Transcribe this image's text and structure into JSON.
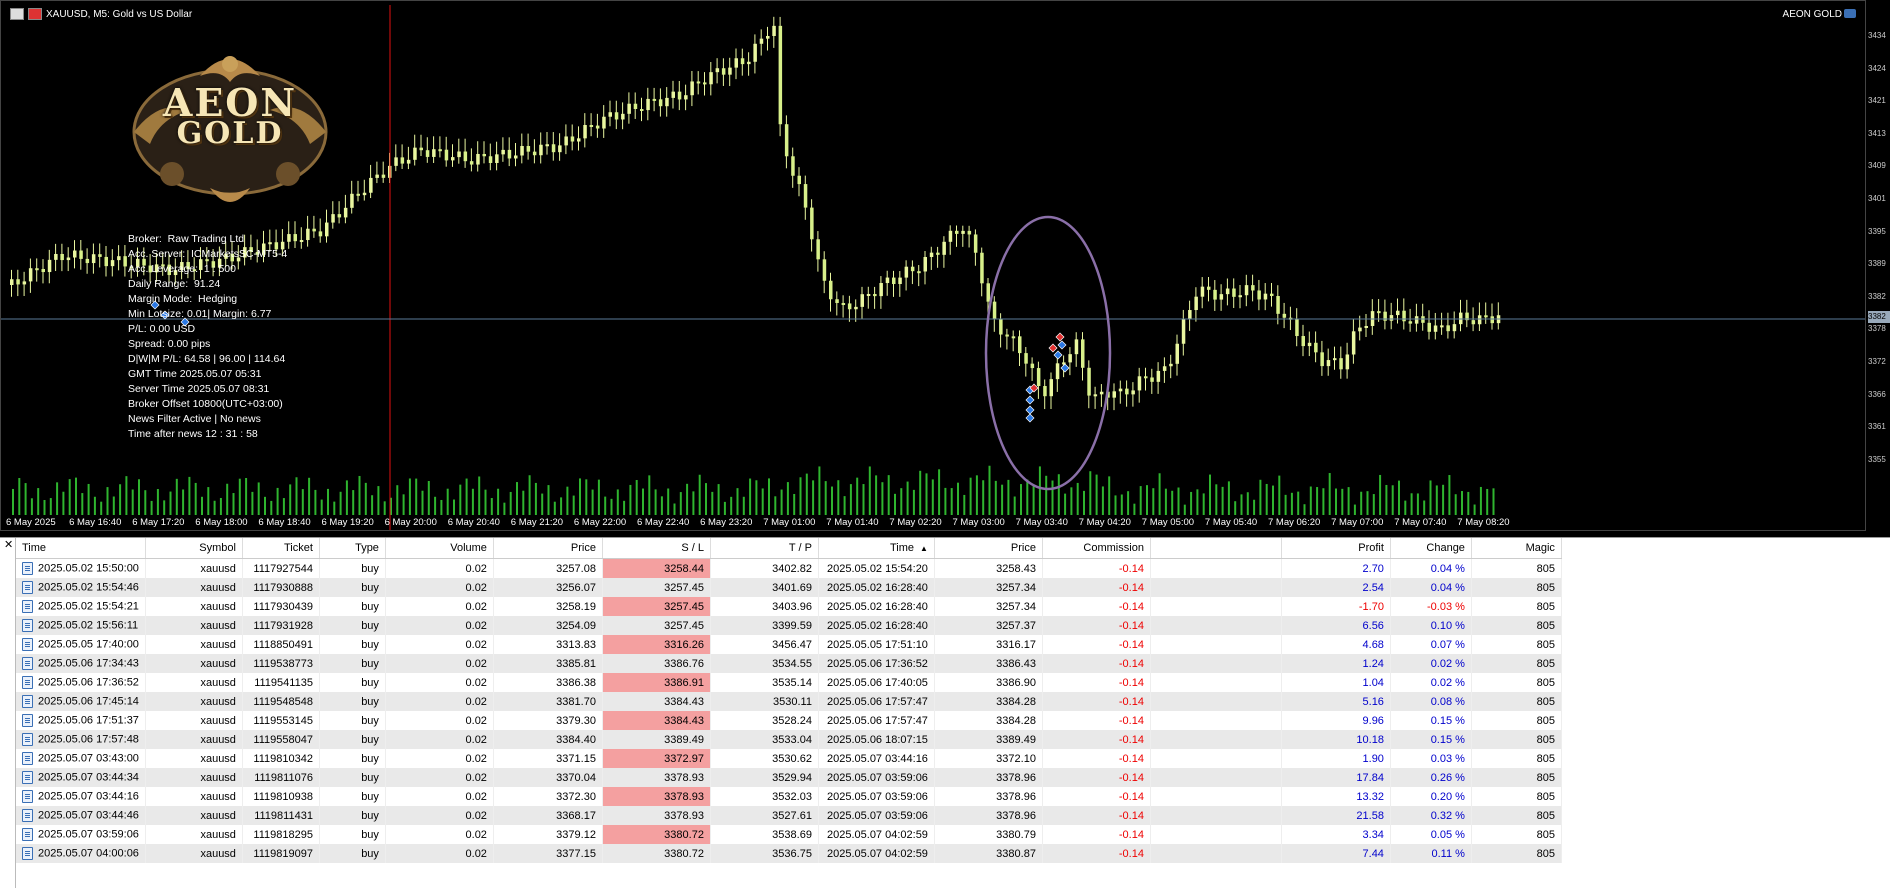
{
  "chart": {
    "symbol_title": "XAUUSD, M5:  Gold vs US Dollar",
    "ea_name": "AEON GOLD",
    "logo_line1": "AEON",
    "logo_line2": "GOLD",
    "current_price_label": "3382",
    "price_labels": [
      "3434",
      "3424",
      "3421",
      "3413",
      "3409",
      "3401",
      "3395",
      "3389",
      "3382",
      "3378",
      "3372",
      "3366",
      "3361",
      "3355"
    ],
    "time_labels": [
      "6 May 2025",
      "6 May 16:40",
      "6 May 17:20",
      "6 May 18:00",
      "6 May 18:40",
      "6 May 19:20",
      "6 May 20:00",
      "6 May 20:40",
      "6 May 21:20",
      "6 May 22:00",
      "6 May 22:40",
      "6 May 23:20",
      "7 May 01:00",
      "7 May 01:40",
      "7 May 02:20",
      "7 May 03:00",
      "7 May 03:40",
      "7 May 04:20",
      "7 May 05:00",
      "7 May 05:40",
      "7 May 06:20",
      "7 May 07:00",
      "7 May 07:40",
      "7 May 08:20"
    ],
    "info_lines": [
      "Broker:  Raw Trading Ltd",
      "Acc. Server:  ICMarketsSC-MT5-4",
      "Acc. Leverage:  1 : 500",
      "Daily Range:  91.24",
      "Margin Mode:  Hedging",
      "Min Lotsize: 0.01| Margin: 6.77",
      "P/L: 0.00 USD",
      "Spread: 0.00 pips",
      "D|W|M P/L: 64.58 | 96.00 | 114.64",
      "GMT Time 2025.05.07 05:31",
      "Server Time 2025.05.07 08:31",
      "Broker Offset 10800(UTC+03:00)",
      "News Filter Active | No news",
      "Time after news 12 : 31 : 58"
    ],
    "colors": {
      "bull": "#eaf7a0",
      "bear": "#d8f08a",
      "volume": "#2fb52f",
      "vline": "#e01010",
      "hline": "#5a7a99",
      "ellipse": "#8a6fa8"
    }
  },
  "terminal": {
    "columns": [
      "Time",
      "Symbol",
      "Ticket",
      "Type",
      "Volume",
      "Price",
      "S / L",
      "T / P",
      "Time",
      "Price",
      "Commission",
      "",
      "Profit",
      "Change",
      "Magic"
    ],
    "rows": [
      [
        "2025.05.02 15:50:00",
        "xauusd",
        "1117927544",
        "buy",
        "0.02",
        "3257.08",
        "3258.44",
        "3402.82",
        "2025.05.02 15:54:20",
        "3258.43",
        "-0.14",
        "",
        "2.70",
        "0.04 %",
        "805"
      ],
      [
        "2025.05.02 15:54:46",
        "xauusd",
        "1117930888",
        "buy",
        "0.02",
        "3256.07",
        "3257.45",
        "3401.69",
        "2025.05.02 16:28:40",
        "3257.34",
        "-0.14",
        "",
        "2.54",
        "0.04 %",
        "805"
      ],
      [
        "2025.05.02 15:54:21",
        "xauusd",
        "1117930439",
        "buy",
        "0.02",
        "3258.19",
        "3257.45",
        "3403.96",
        "2025.05.02 16:28:40",
        "3257.34",
        "-0.14",
        "",
        "-1.70",
        "-0.03 %",
        "805"
      ],
      [
        "2025.05.02 15:56:11",
        "xauusd",
        "1117931928",
        "buy",
        "0.02",
        "3254.09",
        "3257.45",
        "3399.59",
        "2025.05.02 16:28:40",
        "3257.37",
        "-0.14",
        "",
        "6.56",
        "0.10 %",
        "805"
      ],
      [
        "2025.05.05 17:40:00",
        "xauusd",
        "1118850491",
        "buy",
        "0.02",
        "3313.83",
        "3316.26",
        "3456.47",
        "2025.05.05 17:51:10",
        "3316.17",
        "-0.14",
        "",
        "4.68",
        "0.07 %",
        "805"
      ],
      [
        "2025.05.06 17:34:43",
        "xauusd",
        "1119538773",
        "buy",
        "0.02",
        "3385.81",
        "3386.76",
        "3534.55",
        "2025.05.06 17:36:52",
        "3386.43",
        "-0.14",
        "",
        "1.24",
        "0.02 %",
        "805"
      ],
      [
        "2025.05.06 17:36:52",
        "xauusd",
        "1119541135",
        "buy",
        "0.02",
        "3386.38",
        "3386.91",
        "3535.14",
        "2025.05.06 17:40:05",
        "3386.90",
        "-0.14",
        "",
        "1.04",
        "0.02 %",
        "805"
      ],
      [
        "2025.05.06 17:45:14",
        "xauusd",
        "1119548548",
        "buy",
        "0.02",
        "3381.70",
        "3384.43",
        "3530.11",
        "2025.05.06 17:57:47",
        "3384.28",
        "-0.14",
        "",
        "5.16",
        "0.08 %",
        "805"
      ],
      [
        "2025.05.06 17:51:37",
        "xauusd",
        "1119553145",
        "buy",
        "0.02",
        "3379.30",
        "3384.43",
        "3528.24",
        "2025.05.06 17:57:47",
        "3384.28",
        "-0.14",
        "",
        "9.96",
        "0.15 %",
        "805"
      ],
      [
        "2025.05.06 17:57:48",
        "xauusd",
        "1119558047",
        "buy",
        "0.02",
        "3384.40",
        "3389.49",
        "3533.04",
        "2025.05.06 18:07:15",
        "3389.49",
        "-0.14",
        "",
        "10.18",
        "0.15 %",
        "805"
      ],
      [
        "2025.05.07 03:43:00",
        "xauusd",
        "1119810342",
        "buy",
        "0.02",
        "3371.15",
        "3372.97",
        "3530.62",
        "2025.05.07 03:44:16",
        "3372.10",
        "-0.14",
        "",
        "1.90",
        "0.03 %",
        "805"
      ],
      [
        "2025.05.07 03:44:34",
        "xauusd",
        "1119811076",
        "buy",
        "0.02",
        "3370.04",
        "3378.93",
        "3529.94",
        "2025.05.07 03:59:06",
        "3378.96",
        "-0.14",
        "",
        "17.84",
        "0.26 %",
        "805"
      ],
      [
        "2025.05.07 03:44:16",
        "xauusd",
        "1119810938",
        "buy",
        "0.02",
        "3372.30",
        "3378.93",
        "3532.03",
        "2025.05.07 03:59:06",
        "3378.96",
        "-0.14",
        "",
        "13.32",
        "0.20 %",
        "805"
      ],
      [
        "2025.05.07 03:44:46",
        "xauusd",
        "1119811431",
        "buy",
        "0.02",
        "3368.17",
        "3378.93",
        "3527.61",
        "2025.05.07 03:59:06",
        "3378.96",
        "-0.14",
        "",
        "21.58",
        "0.32 %",
        "805"
      ],
      [
        "2025.05.07 03:59:06",
        "xauusd",
        "1119818295",
        "buy",
        "0.02",
        "3379.12",
        "3380.72",
        "3538.69",
        "2025.05.07 04:02:59",
        "3380.79",
        "-0.14",
        "",
        "3.34",
        "0.05 %",
        "805"
      ],
      [
        "2025.05.07 04:00:06",
        "xauusd",
        "1119819097",
        "buy",
        "0.02",
        "3377.15",
        "3380.72",
        "3536.75",
        "2025.05.07 04:02:59",
        "3380.87",
        "-0.14",
        "",
        "7.44",
        "0.11 %",
        "805"
      ]
    ]
  }
}
